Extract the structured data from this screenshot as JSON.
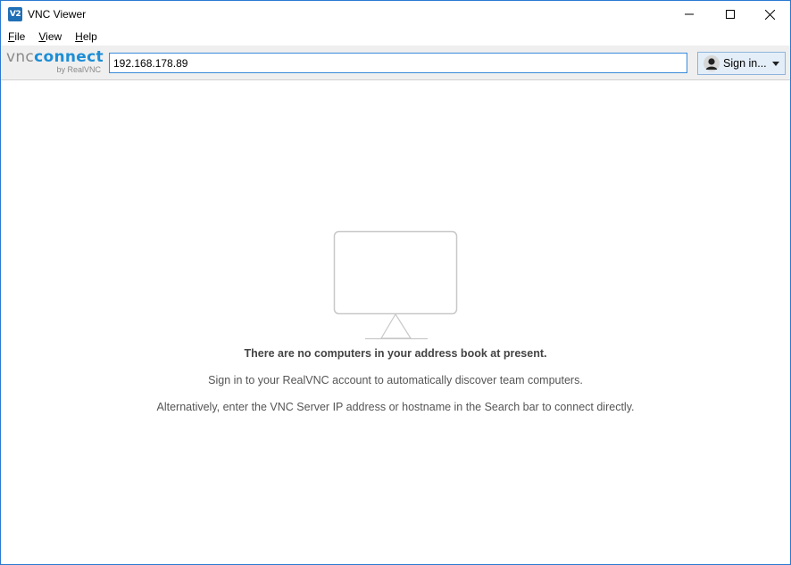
{
  "window": {
    "title": "VNC Viewer",
    "app_icon_text": "V2"
  },
  "menubar": {
    "items": [
      {
        "label": "File",
        "accel": "F",
        "rest": "ile"
      },
      {
        "label": "View",
        "accel": "V",
        "rest": "iew"
      },
      {
        "label": "Help",
        "accel": "H",
        "rest": "elp"
      }
    ]
  },
  "toolbar": {
    "logo": {
      "vnc": "vnc",
      "connect": "connect",
      "sub": "by RealVNC"
    },
    "search": {
      "value": "192.168.178.89",
      "placeholder": ""
    },
    "signin": {
      "label": "Sign in..."
    }
  },
  "empty_state": {
    "title": "There are no computers in your address book at present.",
    "line1": "Sign in to your RealVNC account to automatically discover team computers.",
    "line2": "Alternatively, enter the VNC Server IP address or hostname in the Search bar to connect directly."
  },
  "colors": {
    "accent": "#1d8ed6",
    "window_border": "#2b79d0",
    "toolbar_bg": "#efefef"
  }
}
